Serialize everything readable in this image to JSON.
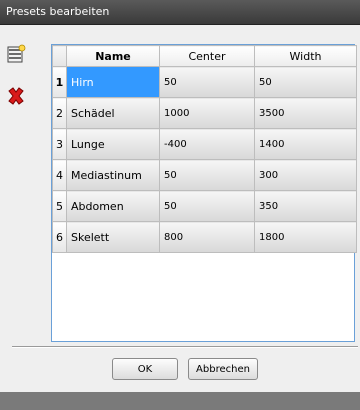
{
  "window": {
    "title": "Presets bearbeiten"
  },
  "toolbar": {
    "add_icon": "add-row-icon",
    "delete_icon": "delete-x-icon"
  },
  "table": {
    "columns": [
      "Name",
      "Center",
      "Width"
    ],
    "rows": [
      {
        "num": "1",
        "name": "Hirn",
        "center": "50",
        "width": "50"
      },
      {
        "num": "2",
        "name": "Schädel",
        "center": "1000",
        "width": "3500"
      },
      {
        "num": "3",
        "name": "Lunge",
        "center": "-400",
        "width": "1400"
      },
      {
        "num": "4",
        "name": "Mediastinum",
        "center": "50",
        "width": "300"
      },
      {
        "num": "5",
        "name": "Abdomen",
        "center": "50",
        "width": "350"
      },
      {
        "num": "6",
        "name": "Skelett",
        "center": "800",
        "width": "1800"
      }
    ]
  },
  "buttons": {
    "ok": "OK",
    "cancel": "Abbrechen"
  },
  "colors": {
    "selection": "#3399ff",
    "grid_border": "#6aa0d8",
    "delete": "#d81b1b"
  }
}
